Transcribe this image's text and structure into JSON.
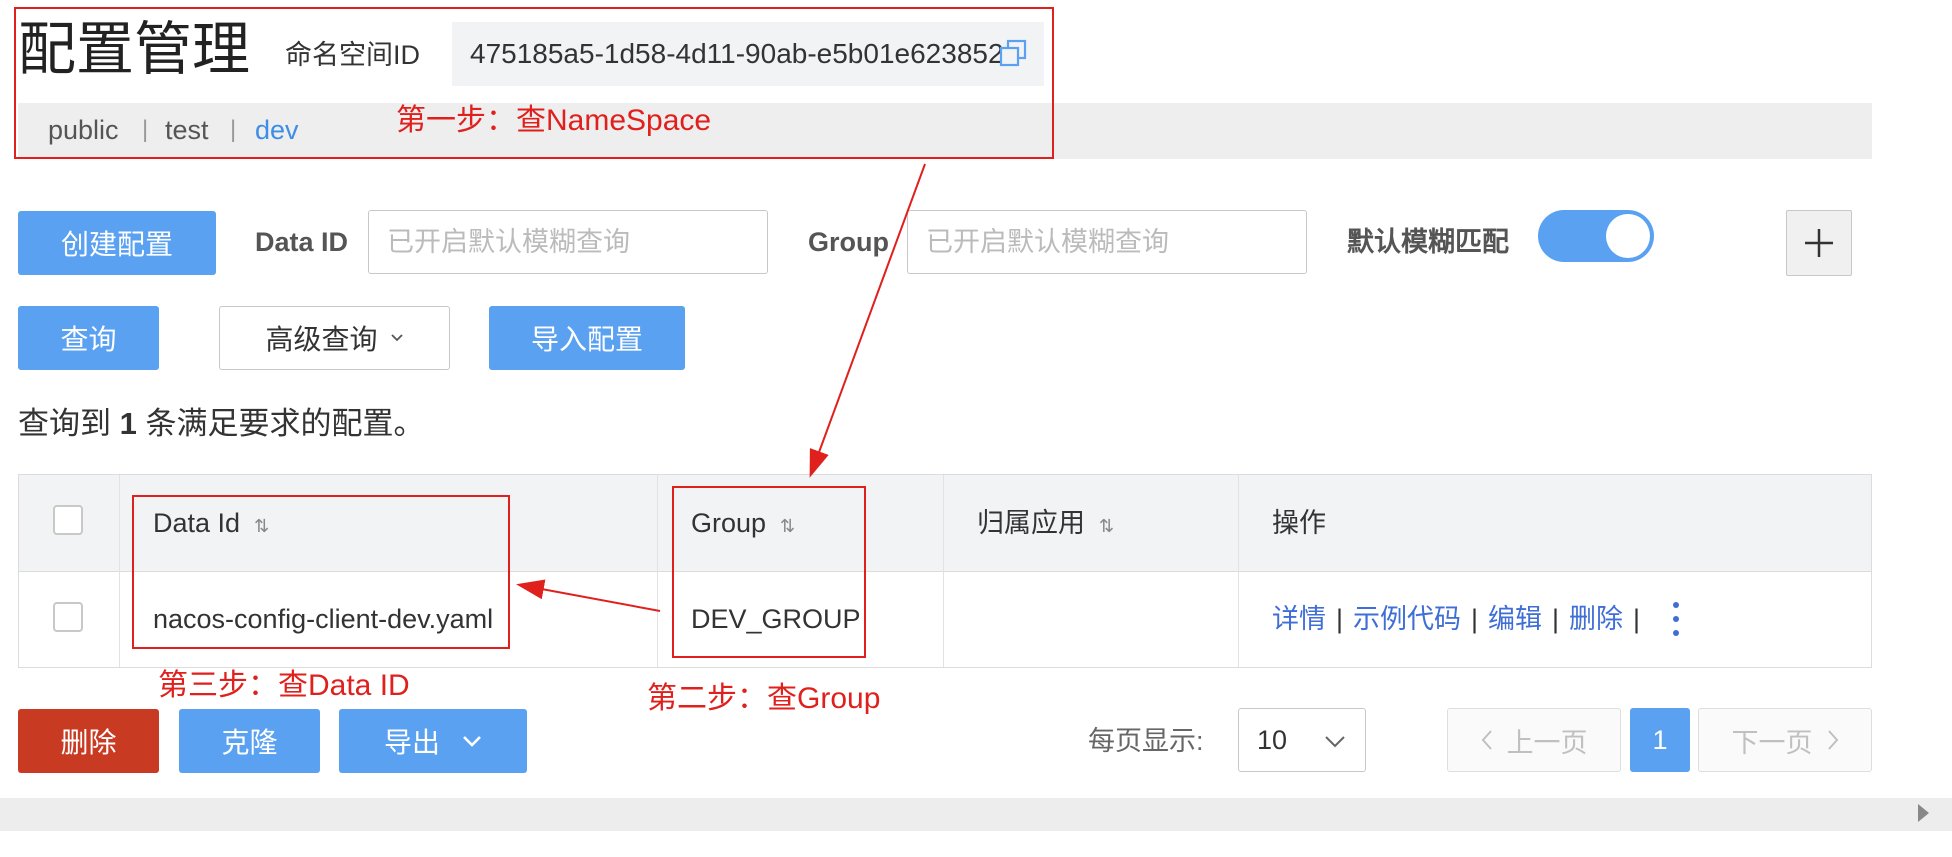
{
  "header": {
    "title": "配置管理",
    "namespace_label": "命名空间ID",
    "namespace_id": "475185a5-1d58-4d11-90ab-e5b01e623852",
    "tabs": [
      {
        "label": "public"
      },
      {
        "label": "test"
      },
      {
        "label": "dev"
      }
    ],
    "tab_separator": "|",
    "active_tab": "dev"
  },
  "toolbar": {
    "create_label": "创建配置",
    "dataid_label": "Data ID",
    "dataid_placeholder": "已开启默认模糊查询",
    "group_label": "Group",
    "group_placeholder": "已开启默认模糊查询",
    "fuzzy_label": "默认模糊匹配",
    "fuzzy_enabled": true,
    "query_label": "查询",
    "advanced_label": "高级查询",
    "import_label": "导入配置"
  },
  "result": {
    "prefix": "查询到",
    "count": "1",
    "suffix": "条满足要求的配置。"
  },
  "table": {
    "columns": [
      "Data Id",
      "Group",
      "归属应用",
      "操作"
    ],
    "rows": [
      {
        "data_id": "nacos-config-client-dev.yaml",
        "group": "DEV_GROUP",
        "app": "",
        "actions": [
          "详情",
          "示例代码",
          "编辑",
          "删除"
        ]
      }
    ],
    "action_separator": "|"
  },
  "footer": {
    "delete_label": "删除",
    "clone_label": "克隆",
    "export_label": "导出",
    "page_size_label": "每页显示:",
    "page_size": "10",
    "prev_label": "上一页",
    "current_page": "1",
    "next_label": "下一页"
  },
  "annotations": {
    "step1": "第一步：查NameSpace",
    "step2": "第二步：查Group",
    "step3": "第三步：查Data ID",
    "color": "#e0201c"
  },
  "colors": {
    "primary": "#5aa1f2",
    "danger": "#c83a22",
    "link": "#3e6ed6",
    "active_tab": "#3c8ee6"
  }
}
